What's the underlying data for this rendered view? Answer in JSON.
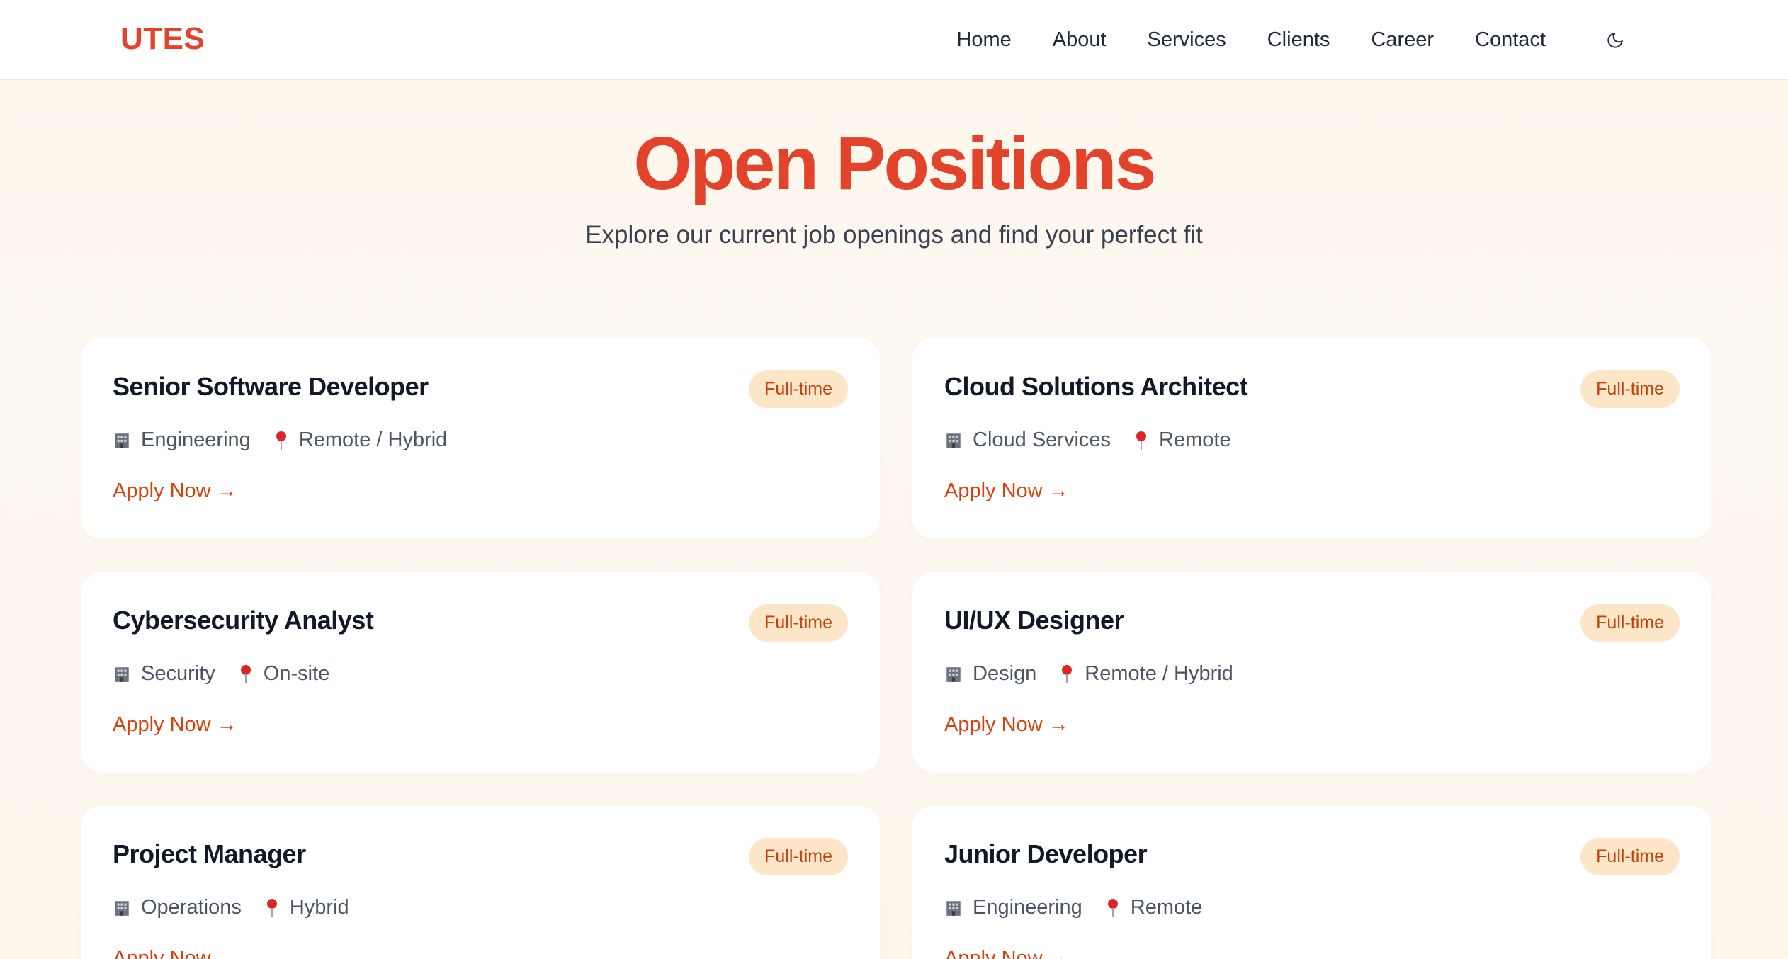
{
  "brand": {
    "logo": "UTES",
    "accent_color": "#e2432a"
  },
  "nav": {
    "items": [
      "Home",
      "About",
      "Services",
      "Clients",
      "Career",
      "Contact"
    ],
    "theme_toggle_icon": "moon-icon"
  },
  "hero": {
    "title": "Open Positions",
    "subtitle": "Explore our current job openings and find your perfect fit"
  },
  "jobs": [
    {
      "title": "Senior Software Developer",
      "type": "Full-time",
      "department": "Engineering",
      "location": "Remote / Hybrid",
      "cta": "Apply Now →"
    },
    {
      "title": "Cloud Solutions Architect",
      "type": "Full-time",
      "department": "Cloud Services",
      "location": "Remote",
      "cta": "Apply Now →"
    },
    {
      "title": "Cybersecurity Analyst",
      "type": "Full-time",
      "department": "Security",
      "location": "On-site",
      "cta": "Apply Now →"
    },
    {
      "title": "UI/UX Designer",
      "type": "Full-time",
      "department": "Design",
      "location": "Remote / Hybrid",
      "cta": "Apply Now →"
    },
    {
      "title": "Project Manager",
      "type": "Full-time",
      "department": "Operations",
      "location": "Hybrid",
      "cta": "Apply Now →"
    },
    {
      "title": "Junior Developer",
      "type": "Full-time",
      "department": "Engineering",
      "location": "Remote",
      "cta": "Apply Now →"
    }
  ]
}
